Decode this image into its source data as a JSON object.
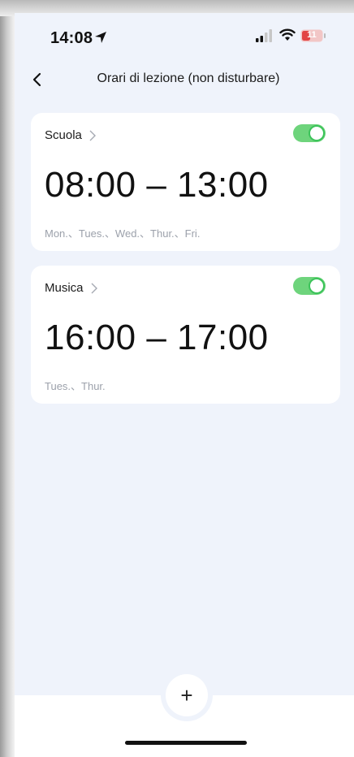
{
  "status_bar": {
    "time": "14:08",
    "battery": "11"
  },
  "nav": {
    "title": "Orari di lezione (non disturbare)"
  },
  "schedules": [
    {
      "name": "Scuola",
      "range": "08:00 – 13:00",
      "days": "Mon.、Tues.、Wed.、Thur.、Fri.",
      "enabled": true
    },
    {
      "name": "Musica",
      "range": "16:00 – 17:00",
      "days": "Tues.、Thur.",
      "enabled": true
    }
  ],
  "add_label": "+",
  "colors": {
    "toggle_on": "#6ed47c",
    "background": "#eff3fb"
  }
}
